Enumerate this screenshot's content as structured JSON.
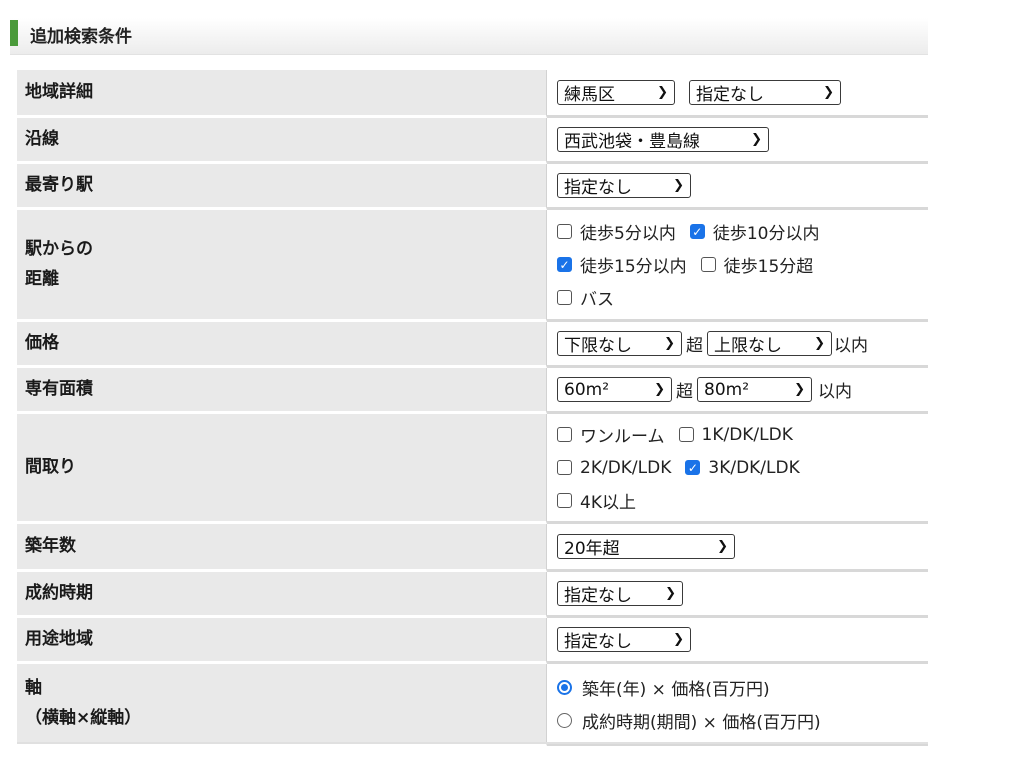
{
  "section": {
    "title": "追加検索条件"
  },
  "rows": {
    "area": {
      "label": "地域詳細",
      "select1": "練馬区",
      "select2": "指定なし"
    },
    "line": {
      "label": "沿線",
      "select": "西武池袋・豊島線"
    },
    "station": {
      "label": "最寄り駅",
      "select": "指定なし"
    },
    "distance": {
      "label_line1": "駅からの",
      "label_line2": "距離",
      "options": [
        {
          "label": "徒歩5分以内",
          "checked": false
        },
        {
          "label": "徒歩10分以内",
          "checked": true
        },
        {
          "label": "徒歩15分以内",
          "checked": true
        },
        {
          "label": "徒歩15分超",
          "checked": false
        },
        {
          "label": "バス",
          "checked": false
        }
      ]
    },
    "price": {
      "label": "価格",
      "min": "下限なし",
      "sep": "超",
      "max": "上限なし",
      "suffix": "以内"
    },
    "size": {
      "label": "専有面積",
      "min": "60m²",
      "sep": "超",
      "max": "80m²",
      "suffix": "以内"
    },
    "layout": {
      "label": "間取り",
      "options": [
        {
          "label": "ワンルーム",
          "checked": false
        },
        {
          "label": "1K/DK/LDK",
          "checked": false
        },
        {
          "label": "2K/DK/LDK",
          "checked": false
        },
        {
          "label": "3K/DK/LDK",
          "checked": true
        },
        {
          "label": "4K以上",
          "checked": false
        }
      ]
    },
    "age": {
      "label": "築年数",
      "select": "20年超"
    },
    "period": {
      "label": "成約時期",
      "select": "指定なし"
    },
    "zoning": {
      "label": "用途地域",
      "select": "指定なし"
    },
    "axis": {
      "label_line1": "軸",
      "label_line2": "（横軸×縦軸）",
      "options": [
        {
          "label": "築年(年) × 価格(百万円)",
          "selected": true
        },
        {
          "label": "成約時期(期間) × 価格(百万円)",
          "selected": false
        }
      ]
    }
  },
  "colors": {
    "accent": "#1a73e8",
    "section_bar": "#4a9a3a",
    "label_bg": "#e9e9e9"
  }
}
